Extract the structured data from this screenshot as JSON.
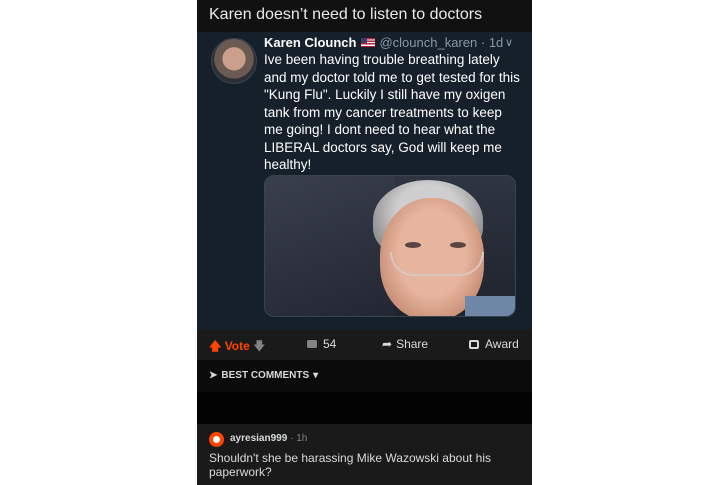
{
  "post": {
    "title": "Karen doesn’t need to listen to doctors"
  },
  "tweet": {
    "name": "Karen Clounch",
    "handle": "@clounch_karen",
    "separator": "·",
    "time": "1d",
    "text": "Ive been having trouble breathing lately and my doctor told me to get tested for this \"Kung Flu\". Luckily I still have my oxigen tank from my cancer treatments to keep me going! I dont need to hear what the LIBERAL doctors say, God will keep me healthy!"
  },
  "actions": {
    "vote_label": "Vote",
    "comments_count": "54",
    "share_label": "Share",
    "award_label": "Award"
  },
  "comments": {
    "sort_label": "BEST COMMENTS",
    "items": [
      {
        "user": "ayresian999",
        "separator": "·",
        "time": "1h",
        "text": "Shouldn't she be harassing Mike Wazowski about his paperwork?"
      }
    ]
  },
  "colors": {
    "accent": "#ff4500",
    "tweet_bg": "#15202b",
    "app_bg": "#1a1a1b"
  },
  "icons": [
    "us-flag-icon",
    "chevron-down-icon",
    "upvote-icon",
    "downvote-icon",
    "comment-icon",
    "share-icon",
    "award-icon",
    "rocket-icon",
    "user-avatar-icon"
  ]
}
